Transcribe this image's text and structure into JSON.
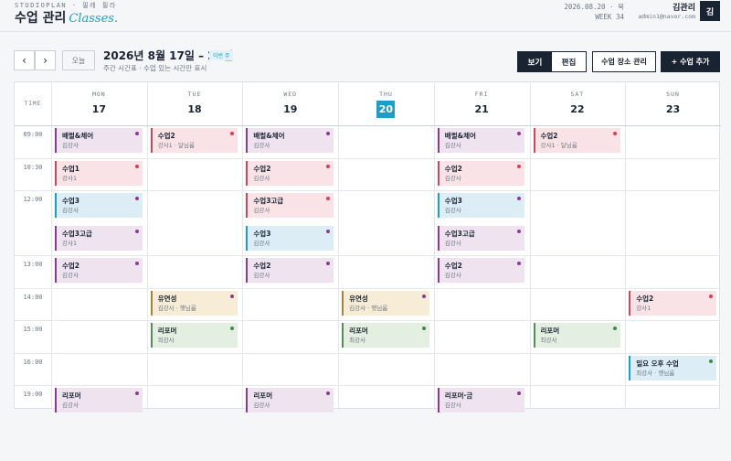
{
  "header": {
    "brand_sub": "STUDIOPLAN · 필레 필라",
    "title": "수업 관리",
    "title_accent": "Classes.",
    "date_line": "2026.08.20 · 목",
    "week_line": "WEEK 34",
    "user_name": "김관리",
    "user_email": "admin1@navor.com",
    "avatar_initial": "김"
  },
  "toolbar": {
    "prev_label": "‹",
    "next_label": "›",
    "today_label": "오늘",
    "range_title": "2026년 8월 17일 – 23일",
    "week_badge": "이번 주",
    "range_sub": "주간 시간표 · 수업 있는 시간만 표시",
    "view_label": "보기",
    "edit_label": "편집",
    "venue_label": "수업 장소 관리",
    "add_label": "+ 수업 추가"
  },
  "calendar": {
    "time_header": "TIME",
    "days": [
      {
        "name": "MON",
        "num": "17",
        "today": false
      },
      {
        "name": "TUE",
        "num": "18",
        "today": false
      },
      {
        "name": "WED",
        "num": "19",
        "today": false
      },
      {
        "name": "THU",
        "num": "20",
        "today": true
      },
      {
        "name": "FRI",
        "num": "21",
        "today": false
      },
      {
        "name": "SAT",
        "num": "22",
        "today": false
      },
      {
        "name": "SUN",
        "num": "23",
        "today": false
      }
    ],
    "rows": [
      {
        "time": "09:00",
        "slots": 1
      },
      {
        "time": "10:30",
        "slots": 1
      },
      {
        "time": "12:00",
        "slots": 2
      },
      {
        "time": "13:00",
        "slots": 1
      },
      {
        "time": "14:00",
        "slots": 1
      },
      {
        "time": "15:00",
        "slots": 1
      },
      {
        "time": "16:00",
        "slots": 1
      },
      {
        "time": "19:00",
        "slots": 1
      }
    ],
    "events": [
      {
        "day": 0,
        "row": 0,
        "slot": 0,
        "title": "배럴&체어",
        "sub": "김강사",
        "color": "purple"
      },
      {
        "day": 1,
        "row": 0,
        "slot": 0,
        "title": "수업2",
        "sub": "강사1 · 달님룸",
        "color": "pink"
      },
      {
        "day": 2,
        "row": 0,
        "slot": 0,
        "title": "배럴&체어",
        "sub": "김강사",
        "color": "purple"
      },
      {
        "day": 4,
        "row": 0,
        "slot": 0,
        "title": "배럴&체어",
        "sub": "김강사",
        "color": "purple"
      },
      {
        "day": 5,
        "row": 0,
        "slot": 0,
        "title": "수업2",
        "sub": "강사1 · 달님룸",
        "color": "pink"
      },
      {
        "day": 0,
        "row": 1,
        "slot": 0,
        "title": "수업1",
        "sub": "강사1",
        "color": "pink"
      },
      {
        "day": 2,
        "row": 1,
        "slot": 0,
        "title": "수업2",
        "sub": "김강사",
        "color": "pink"
      },
      {
        "day": 4,
        "row": 1,
        "slot": 0,
        "title": "수업2",
        "sub": "김강사",
        "color": "pink"
      },
      {
        "day": 0,
        "row": 2,
        "slot": 0,
        "title": "수업3",
        "sub": "김강사",
        "color": "blue"
      },
      {
        "day": 2,
        "row": 2,
        "slot": 0,
        "title": "수업3고급",
        "sub": "김강사",
        "color": "pink"
      },
      {
        "day": 4,
        "row": 2,
        "slot": 0,
        "title": "수업3",
        "sub": "김강사",
        "color": "blue"
      },
      {
        "day": 0,
        "row": 2,
        "slot": 1,
        "title": "수업3고급",
        "sub": "강사1",
        "color": "purple"
      },
      {
        "day": 2,
        "row": 2,
        "slot": 1,
        "title": "수업3",
        "sub": "김강사",
        "color": "blue"
      },
      {
        "day": 4,
        "row": 2,
        "slot": 1,
        "title": "수업3고급",
        "sub": "김강사",
        "color": "purple"
      },
      {
        "day": 0,
        "row": 3,
        "slot": 0,
        "title": "수업2",
        "sub": "김강사",
        "color": "purple"
      },
      {
        "day": 2,
        "row": 3,
        "slot": 0,
        "title": "수업2",
        "sub": "김강사",
        "color": "purple"
      },
      {
        "day": 4,
        "row": 3,
        "slot": 0,
        "title": "수업2",
        "sub": "김강사",
        "color": "purple"
      },
      {
        "day": 1,
        "row": 4,
        "slot": 0,
        "title": "유연성",
        "sub": "김강사 · 햇님룸",
        "color": "tan"
      },
      {
        "day": 3,
        "row": 4,
        "slot": 0,
        "title": "유연성",
        "sub": "김강사 · 햇님룸",
        "color": "tan"
      },
      {
        "day": 6,
        "row": 4,
        "slot": 0,
        "title": "수업2",
        "sub": "강사1",
        "color": "pink"
      },
      {
        "day": 1,
        "row": 5,
        "slot": 0,
        "title": "리포머",
        "sub": "최강사",
        "color": "green"
      },
      {
        "day": 3,
        "row": 5,
        "slot": 0,
        "title": "리포머",
        "sub": "최강사",
        "color": "green"
      },
      {
        "day": 5,
        "row": 5,
        "slot": 0,
        "title": "리포머",
        "sub": "최강사",
        "color": "green"
      },
      {
        "day": 6,
        "row": 6,
        "slot": 0,
        "title": "일요 오후 수업",
        "sub": "최강사 · 햇님룸",
        "color": "blue green-dot"
      },
      {
        "day": 0,
        "row": 7,
        "slot": 0,
        "title": "리포머",
        "sub": "김강사",
        "color": "purple"
      },
      {
        "day": 2,
        "row": 7,
        "slot": 0,
        "title": "리포머",
        "sub": "김강사",
        "color": "purple"
      },
      {
        "day": 4,
        "row": 7,
        "slot": 0,
        "title": "리포머·금",
        "sub": "김강사",
        "color": "purple"
      }
    ]
  }
}
